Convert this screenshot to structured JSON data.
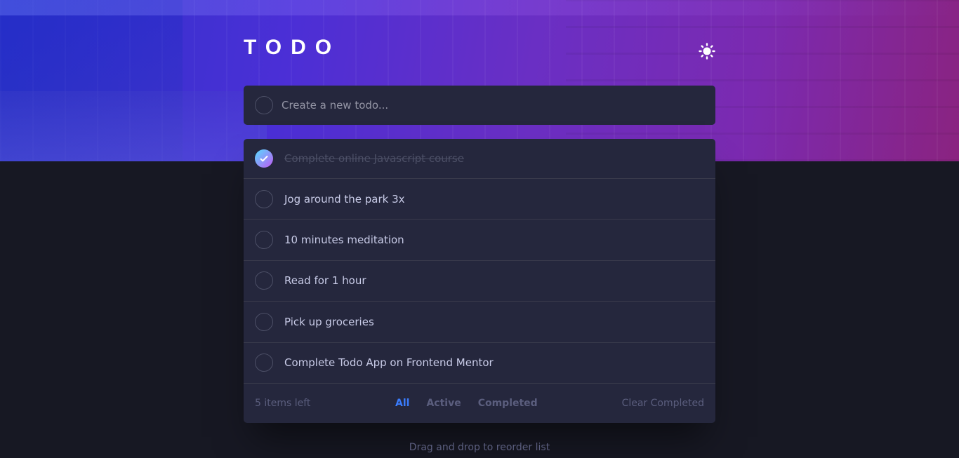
{
  "app": {
    "logo": "TODO",
    "theme_icon": "sun-icon"
  },
  "new_todo": {
    "placeholder": "Create a new todo..."
  },
  "todos": [
    {
      "label": "Complete online Javascript course",
      "completed": true
    },
    {
      "label": "Jog around the park 3x",
      "completed": false
    },
    {
      "label": "10 minutes meditation",
      "completed": false
    },
    {
      "label": "Read for 1 hour",
      "completed": false
    },
    {
      "label": "Pick up groceries",
      "completed": false
    },
    {
      "label": "Complete Todo App on Frontend Mentor",
      "completed": false
    }
  ],
  "footer": {
    "items_left": "5 items left",
    "filters": {
      "all": "All",
      "active": "Active",
      "completed": "Completed"
    },
    "active_filter": "all",
    "clear_label": "Clear Completed"
  },
  "hint": "Drag and drop to reorder list",
  "colors": {
    "accent": "#3a7cfd",
    "check_gradient_start": "#55ddff",
    "check_gradient_end": "#c058f3",
    "card": "#25273d",
    "background": "#171823"
  }
}
